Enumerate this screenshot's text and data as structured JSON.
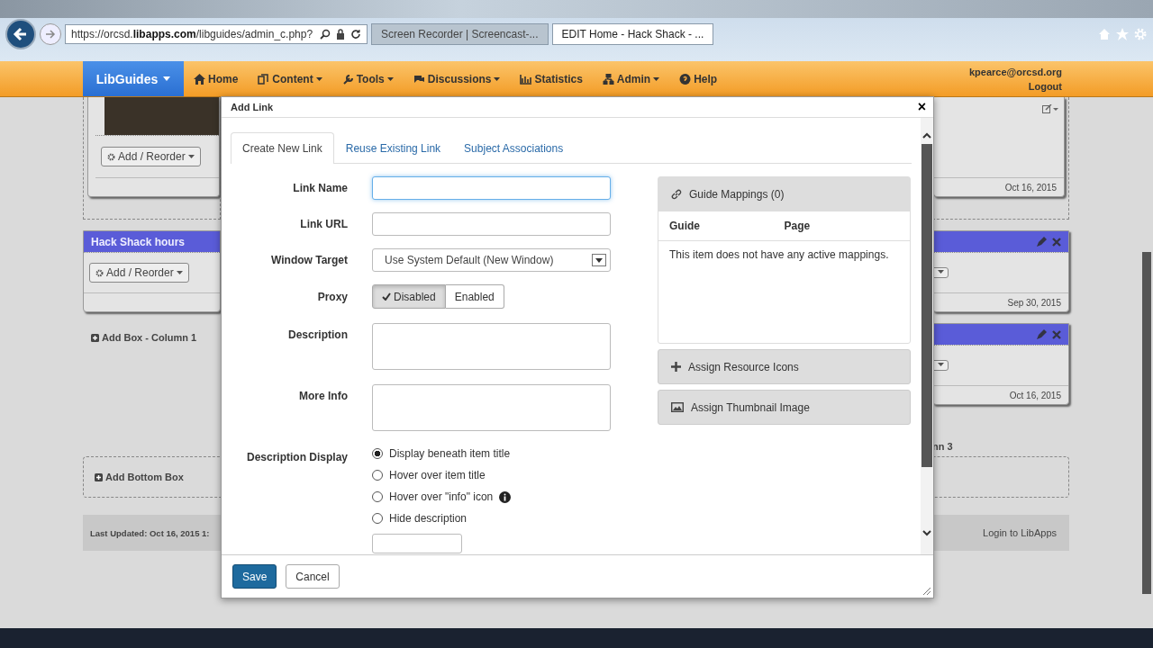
{
  "browser": {
    "url_parts": [
      "https://orcsd.",
      "libapps.com",
      "/libguides/admin_c.php?"
    ],
    "tabs": [
      {
        "title": "Screen Recorder | Screencast-...",
        "selected": false
      },
      {
        "title": "EDIT Home - Hack Shack - ...",
        "selected": true
      }
    ]
  },
  "navbar": {
    "brand": "LibGuides",
    "items": [
      {
        "label": "Home",
        "dropdown": false
      },
      {
        "label": "Content",
        "dropdown": true
      },
      {
        "label": "Tools",
        "dropdown": true
      },
      {
        "label": "Discussions",
        "dropdown": true
      },
      {
        "label": "Statistics",
        "dropdown": false
      },
      {
        "label": "Admin",
        "dropdown": true
      },
      {
        "label": "Help",
        "dropdown": false
      }
    ],
    "user": "kpearce@orcsd.org",
    "logout": "Logout"
  },
  "page": {
    "left": {
      "box1_button": "Add / Reorder",
      "box2_title": "Hack Shack hours",
      "box2_button": "Add / Reorder",
      "add_box": "Add Box - Column 1"
    },
    "right": {
      "dates": [
        "Oct 16, 2015",
        "Sep 30, 2015",
        "Oct 16, 2015"
      ],
      "column_link": "nn 3"
    },
    "add_bottom_box": "Add Bottom Box",
    "last_updated": "Last Updated: Oct 16, 2015 1:",
    "login": "Login to LibApps"
  },
  "modal": {
    "title": "Add Link",
    "close": "×",
    "tabs": [
      {
        "label": "Create New Link",
        "selected": true
      },
      {
        "label": "Reuse Existing Link",
        "selected": false
      },
      {
        "label": "Subject Associations",
        "selected": false
      }
    ],
    "link_name": {
      "label": "Link Name",
      "focused": true
    },
    "link_url": {
      "label": "Link URL"
    },
    "window_target": {
      "label": "Window Target",
      "value": "Use System Default (New Window)"
    },
    "proxy": {
      "label": "Proxy",
      "options": [
        {
          "label": "Disabled",
          "selected": true
        },
        {
          "label": "Enabled",
          "selected": false
        }
      ]
    },
    "description": {
      "label": "Description"
    },
    "more_info": {
      "label": "More Info"
    },
    "description_display": {
      "label": "Description Display",
      "options": [
        {
          "label": "Display beneath item title",
          "selected": true,
          "info_icon": false
        },
        {
          "label": "Hover over item title",
          "selected": false,
          "info_icon": false
        },
        {
          "label": "Hover over \"info\" icon",
          "selected": false,
          "info_icon": true
        },
        {
          "label": "Hide description",
          "selected": false,
          "info_icon": false
        }
      ]
    },
    "mappings": {
      "title": "Guide Mappings (0)",
      "columns": [
        "Guide",
        "Page"
      ],
      "empty": "This item does not have any active mappings."
    },
    "panels": [
      {
        "label": "Assign Resource Icons"
      },
      {
        "label": "Assign Thumbnail Image"
      }
    ],
    "buttons": [
      {
        "label": "Save",
        "primary": true
      },
      {
        "label": "Cancel",
        "primary": false
      }
    ]
  }
}
